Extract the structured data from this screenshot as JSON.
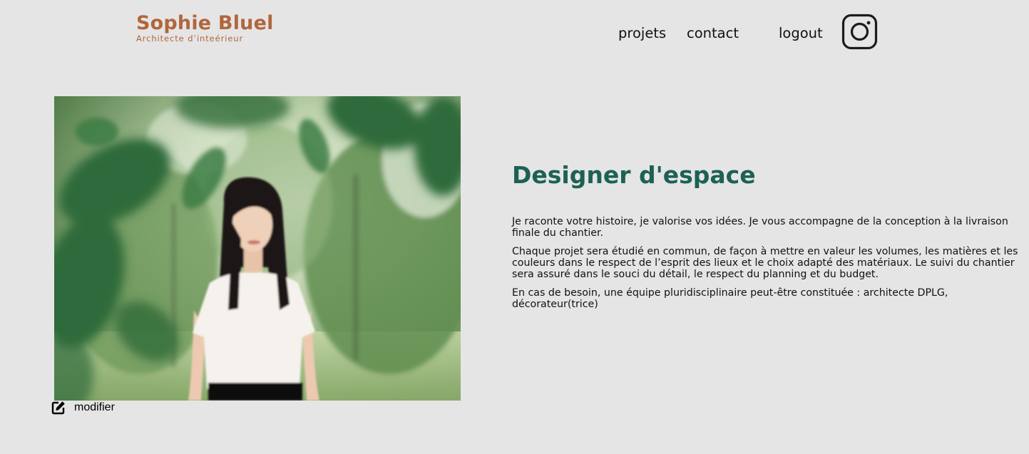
{
  "header": {
    "logo_name": "Sophie Bluel",
    "logo_subtitle": "Architecte d’inteérieur",
    "nav": {
      "projets": "projets",
      "contact": "contact",
      "logout": "logout"
    },
    "social_icon": "instagram-icon"
  },
  "introduction": {
    "photo_description_icon": "portrait-photo",
    "edit_label": "modifier",
    "edit_icon": "pen-to-square-icon",
    "title": "Designer d'espace",
    "paragraphs": [
      "Je raconte votre histoire, je valorise vos idées. Je vous accompagne de la conception à la livraison finale du chantier.",
      "Chaque projet sera étudié en commun, de façon à mettre en valeur les volumes, les matières et les couleurs dans le respect de l’esprit des lieux et le choix adapté des matériaux. Le suivi du chantier sera assuré dans le souci du détail, le respect du planning et du budget.",
      "En cas de besoin, une équipe pluridisciplinaire peut-être constituée : architecte DPLG, décorateur(trice)"
    ]
  },
  "colors": {
    "background": "#e5e5e5",
    "brand": "#b1663c",
    "title": "#1d6154",
    "text": "#111111"
  }
}
